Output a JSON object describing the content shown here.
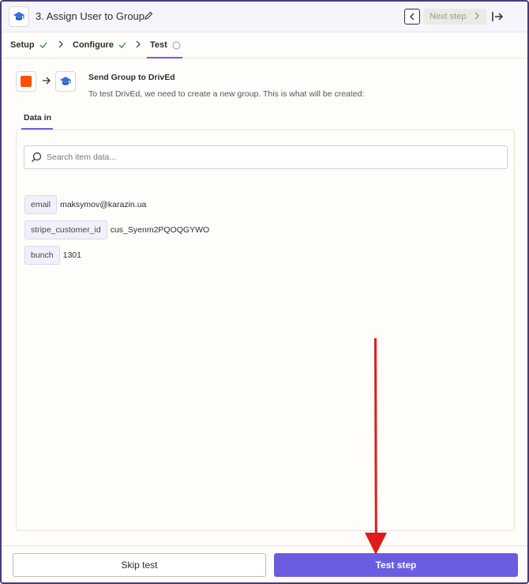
{
  "header": {
    "step_title": "3. Assign User to Group",
    "next_step_label": "Next step"
  },
  "tabs": [
    {
      "label": "Setup",
      "state": "complete"
    },
    {
      "label": "Configure",
      "state": "complete"
    },
    {
      "label": "Test",
      "state": "active"
    }
  ],
  "action": {
    "title": "Send Group to DrivEd",
    "description": "To test DrivEd, we need to create a new group. This is what will be created:"
  },
  "data_tabs": [
    {
      "label": "Data in",
      "active": true
    }
  ],
  "search": {
    "placeholder": "Search item data...",
    "value": ""
  },
  "fields": [
    {
      "key": "email",
      "value": "maksymov@karazin.ua"
    },
    {
      "key": "stripe_customer_id",
      "value": "cus_Syenm2PQOQGYWO"
    },
    {
      "key": "bunch",
      "value": "1301"
    }
  ],
  "footer": {
    "skip_label": "Skip test",
    "test_label": "Test step"
  },
  "colors": {
    "accent": "#6b5ddf",
    "source_app": "#ff4f00",
    "annotation_arrow": "#e01b1b",
    "check": "#1f8a4c"
  },
  "icons": {
    "app": "graduation-cap-icon",
    "edit": "pencil-icon",
    "exit": "exit-to-right-icon"
  }
}
